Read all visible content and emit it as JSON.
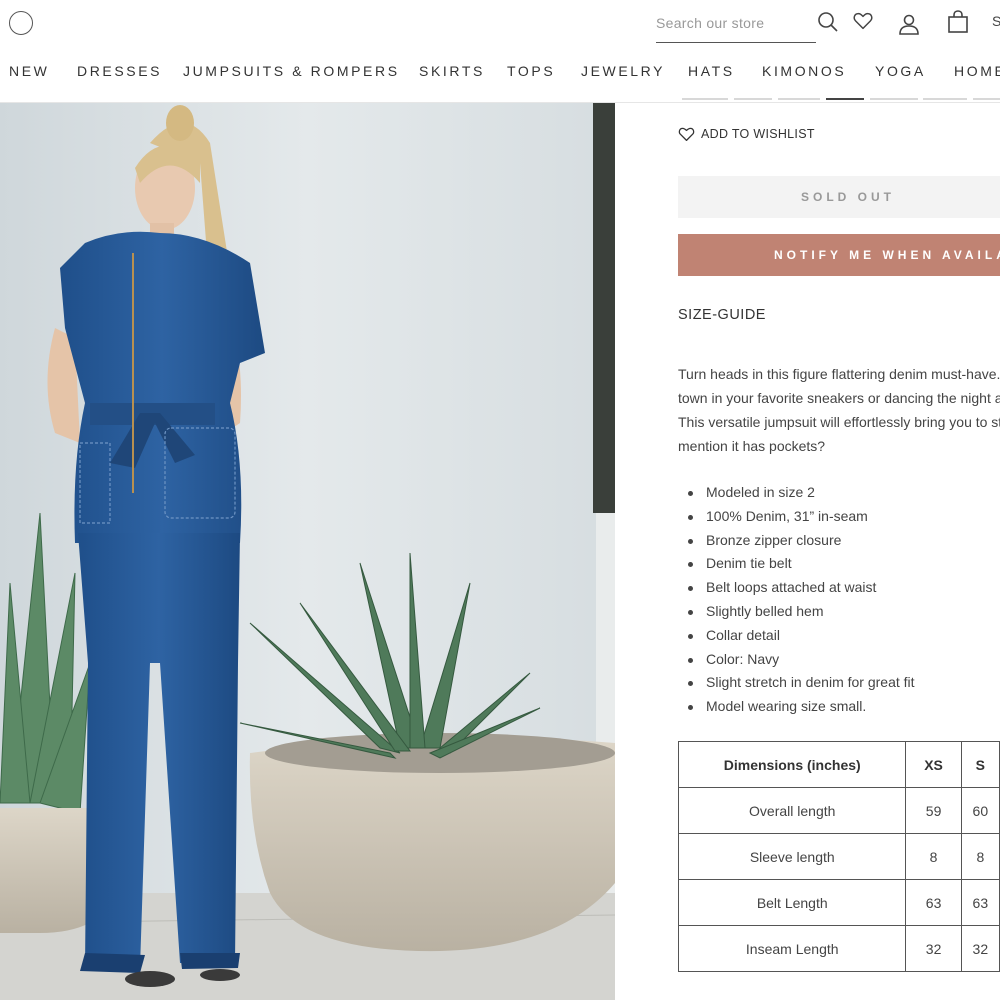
{
  "header": {
    "search_placeholder": "Search our store",
    "cut_letter": "S",
    "nav": [
      {
        "label": "NEW",
        "key": "new"
      },
      {
        "label": "DRESSES",
        "key": "dresses"
      },
      {
        "label": "JUMPSUITS & ROMPERS",
        "key": "jumpsuits"
      },
      {
        "label": "SKIRTS",
        "key": "skirts"
      },
      {
        "label": "TOPS",
        "key": "tops"
      },
      {
        "label": "JEWELRY",
        "key": "jewelry"
      },
      {
        "label": "HATS",
        "key": "hats"
      },
      {
        "label": "KIMONOS",
        "key": "kimonos"
      },
      {
        "label": "YOGA",
        "key": "yoga"
      },
      {
        "label": "HOME",
        "key": "home"
      }
    ]
  },
  "product": {
    "wishlist_label": "ADD TO WISHLIST",
    "sold_out_label": "SOLD OUT",
    "notify_label": "NOTIFY ME WHEN AVAILABLE",
    "size_guide_label": "SIZE-GUIDE",
    "description_lines": [
      "Turn heads in this figure flattering denim must-have.",
      "town in your favorite sneakers or dancing the night away",
      "This versatile jumpsuit will effortlessly bring you to style",
      "mention it has pockets?"
    ],
    "features": [
      "Modeled in size 2",
      "100% Denim, 31” in-seam",
      "Bronze zipper closure",
      "Denim tie belt",
      "Belt loops attached at waist",
      "Slightly belled hem",
      "Collar detail",
      "Color: Navy",
      "Slight stretch in denim for great fit",
      "Model wearing size small."
    ],
    "dimensions": {
      "headers": [
        "Dimensions (inches)",
        "XS",
        "S"
      ],
      "rows": [
        [
          "Overall length",
          "59",
          "60"
        ],
        [
          "Sleeve length",
          "8",
          "8"
        ],
        [
          "Belt Length",
          "63",
          "63"
        ],
        [
          "Inseam Length",
          "32",
          "32"
        ]
      ]
    }
  },
  "colors": {
    "accent": "#c08373",
    "sold_out_bg": "#f3f3f3",
    "text": "#333333"
  }
}
